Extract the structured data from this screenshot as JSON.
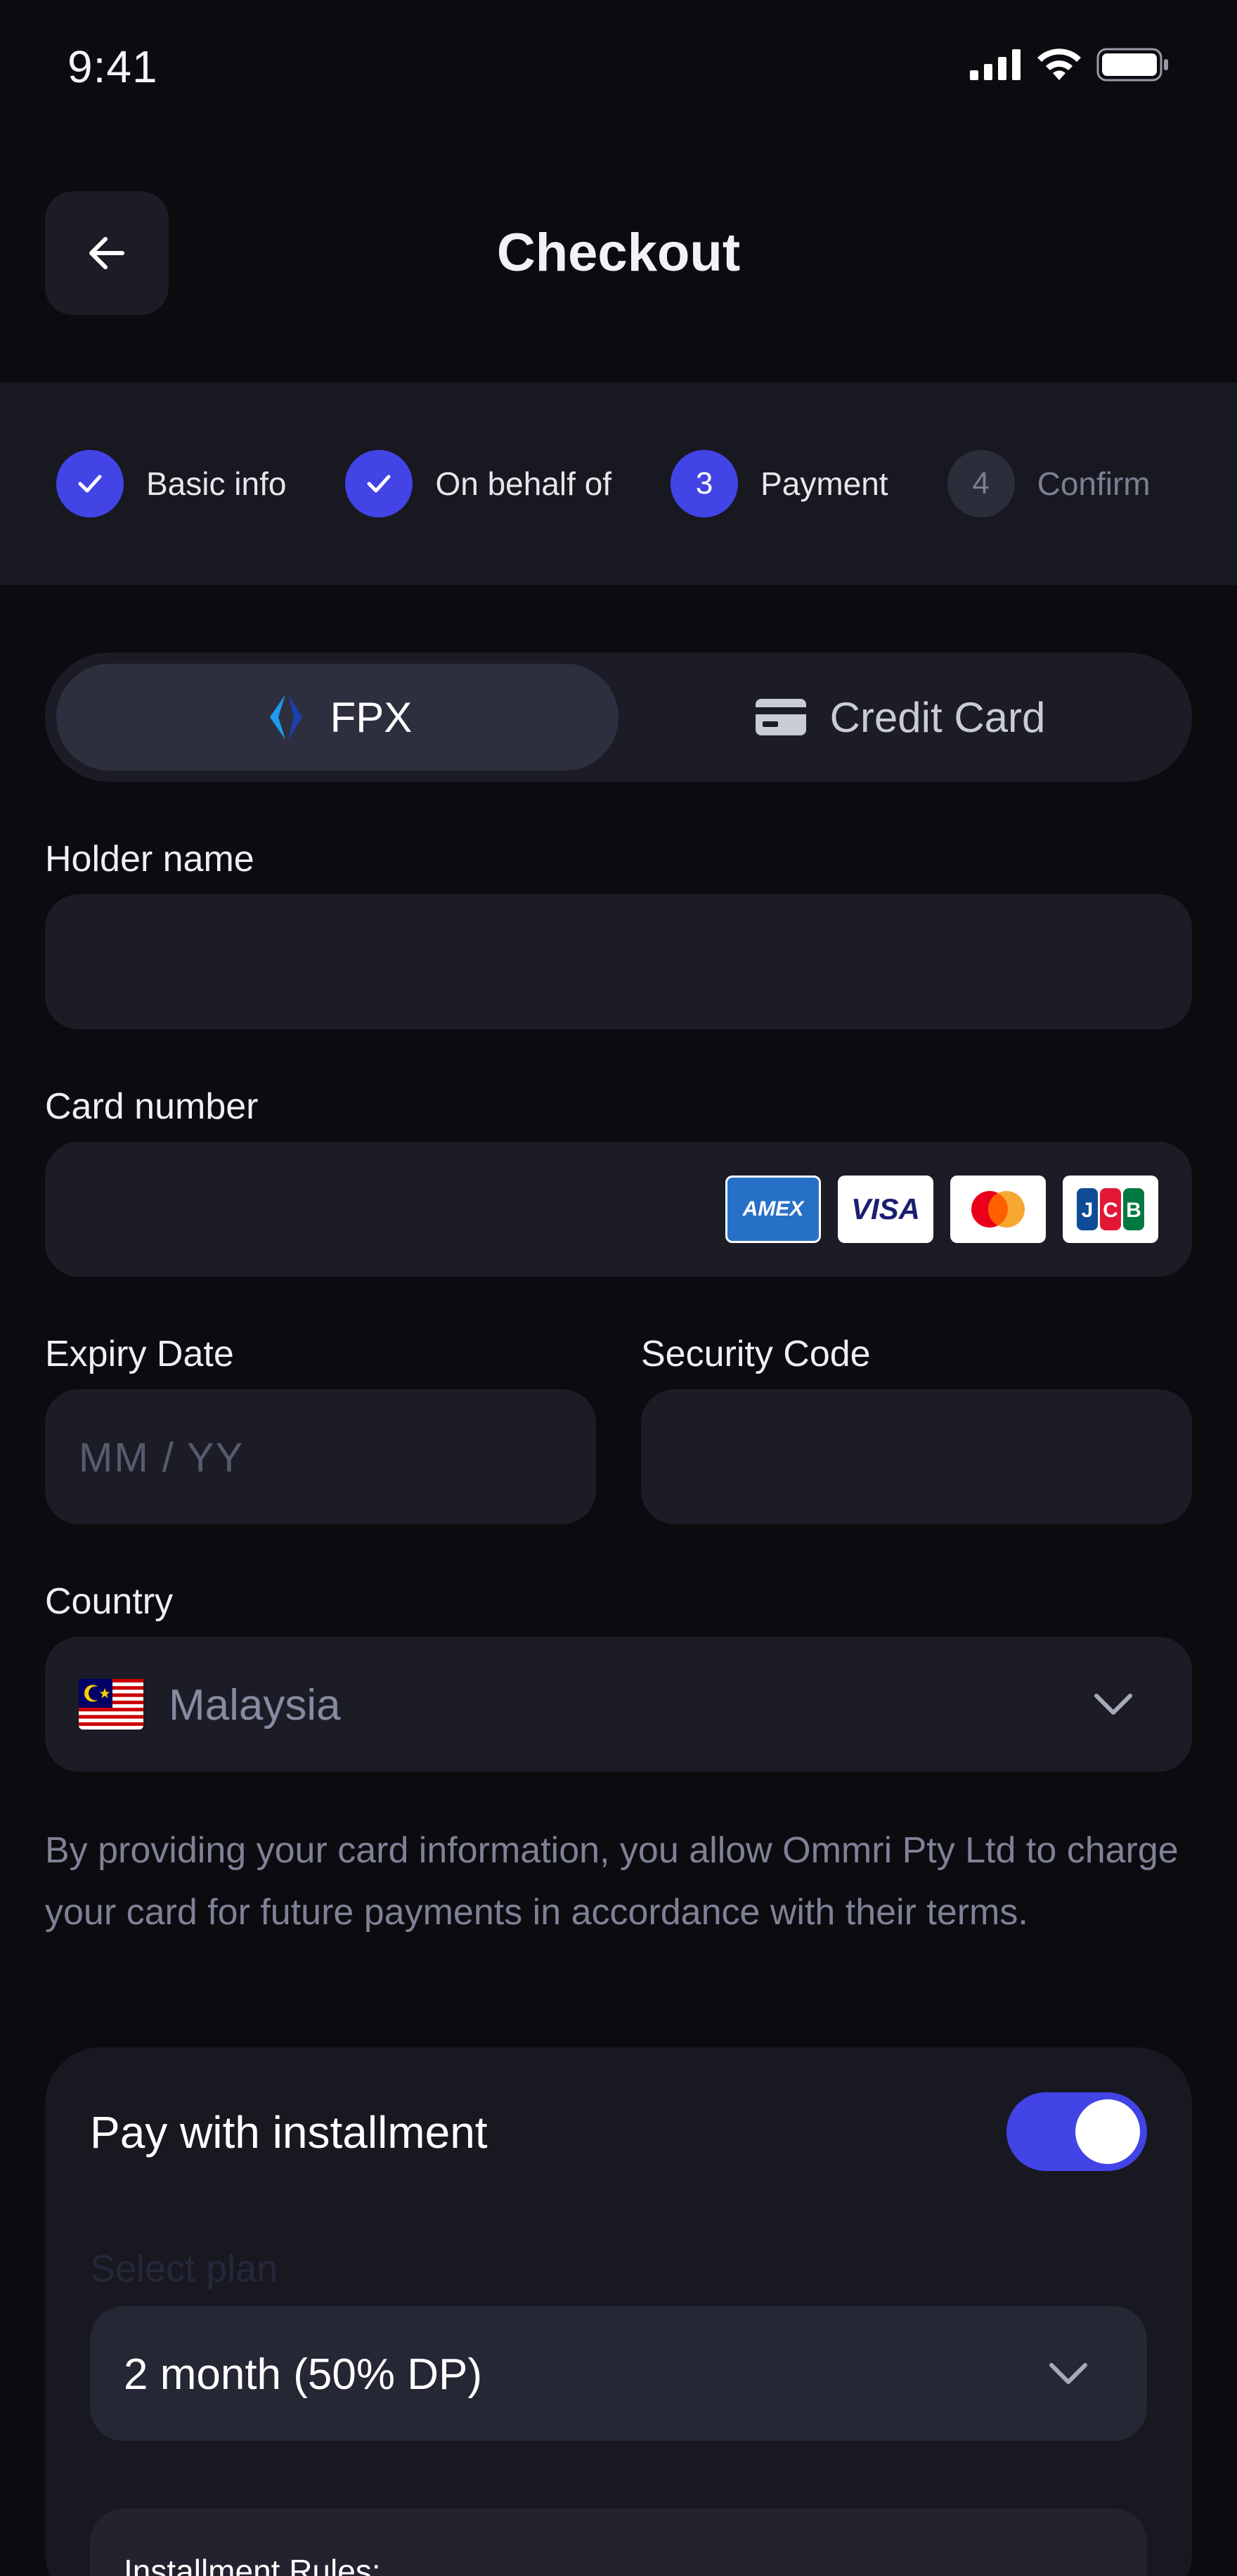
{
  "status_bar": {
    "time": "9:41"
  },
  "header": {
    "title": "Checkout"
  },
  "stepper": {
    "steps": [
      {
        "label": "Basic info",
        "marker": "✓",
        "state": "done"
      },
      {
        "label": "On behalf of",
        "marker": "✓",
        "state": "done"
      },
      {
        "label": "Payment",
        "marker": "3",
        "state": "active"
      },
      {
        "label": "Confirm",
        "marker": "4",
        "state": "pending"
      }
    ]
  },
  "payment_methods": {
    "fpx": "FPX",
    "credit_card": "Credit Card",
    "selected": "FPX"
  },
  "form": {
    "holder_name": {
      "label": "Holder name",
      "value": ""
    },
    "card_number": {
      "label": "Card number",
      "value": "",
      "logos": [
        "AMEX",
        "VISA",
        "mastercard",
        "JCB"
      ]
    },
    "expiry": {
      "label": "Expiry Date",
      "placeholder": "MM / YY"
    },
    "security_code": {
      "label": "Security Code",
      "value": ""
    },
    "country": {
      "label": "Country",
      "value": "Malaysia",
      "flag_icon": "malaysia-flag-icon"
    }
  },
  "disclaimer": "By providing your card information, you allow Ommri Pty Ltd to charge your card for future payments in accordance with their terms.",
  "installment": {
    "title": "Pay with installment",
    "enabled": true,
    "select_plan_label": "Select plan",
    "plan_value": "2 month (50% DP)",
    "rules_title": "Installment Rules:"
  },
  "colors": {
    "background": "#0b0b10",
    "surface": "#1c1c26",
    "accent": "#4244e6",
    "muted_text": "#7f8296"
  }
}
